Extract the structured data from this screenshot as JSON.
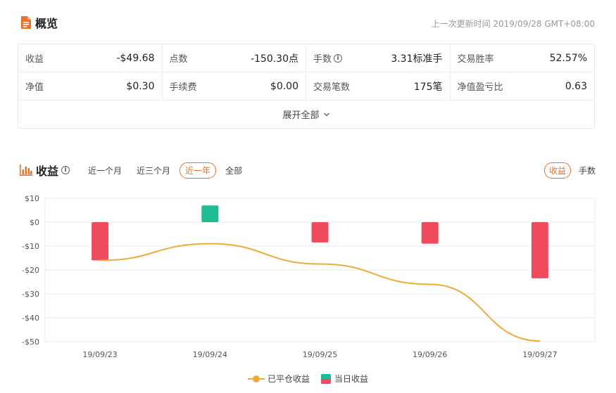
{
  "overview": {
    "title": "概览",
    "icon": "document-icon",
    "updated": "上一次更新时间 2019/09/28 GMT+08:00"
  },
  "stats": [
    {
      "label": "收益",
      "value": "-$49.68",
      "info": false
    },
    {
      "label": "点数",
      "value": "-150.30点",
      "info": false
    },
    {
      "label": "手数",
      "value": "3.31标准手",
      "info": true
    },
    {
      "label": "交易胜率",
      "value": "52.57%",
      "info": false
    },
    {
      "label": "净值",
      "value": "$0.30",
      "info": false
    },
    {
      "label": "手续费",
      "value": "$0.00",
      "info": false
    },
    {
      "label": "交易笔数",
      "value": "175笔",
      "info": false
    },
    {
      "label": "净值盈亏比",
      "value": "0.63",
      "info": false
    }
  ],
  "expand_label": "展开全部",
  "profit_section": {
    "title": "收益",
    "icon": "bar-chart-icon",
    "info_icon": "info-icon",
    "ranges": [
      "近一个月",
      "近三个月",
      "近一年",
      "全部"
    ],
    "active_range": "近一年",
    "metrics": [
      "收益",
      "手数"
    ],
    "active_metric": "收益"
  },
  "colors": {
    "accent": "#e8732a",
    "line": "#f0a93b",
    "positive": "#1dbc91",
    "negative": "#ef4b5d"
  },
  "chart_data": {
    "type": "bar",
    "categories": [
      "19/09/23",
      "19/09/24",
      "19/09/25",
      "19/09/26",
      "19/09/27"
    ],
    "y_ticks": [
      "$10",
      "$0",
      "-$10",
      "-$20",
      "-$30",
      "-$40",
      "-$50"
    ],
    "ylim": [
      -50,
      10
    ],
    "grid": true,
    "legend_position": "bottom",
    "series": [
      {
        "name": "已平仓收益",
        "type": "line",
        "values": [
          -16,
          -9,
          -17.5,
          -26,
          -49.7
        ]
      },
      {
        "name": "当日收益",
        "type": "bar",
        "values": [
          -16,
          7,
          -8.5,
          -9,
          -23.5
        ]
      }
    ]
  }
}
